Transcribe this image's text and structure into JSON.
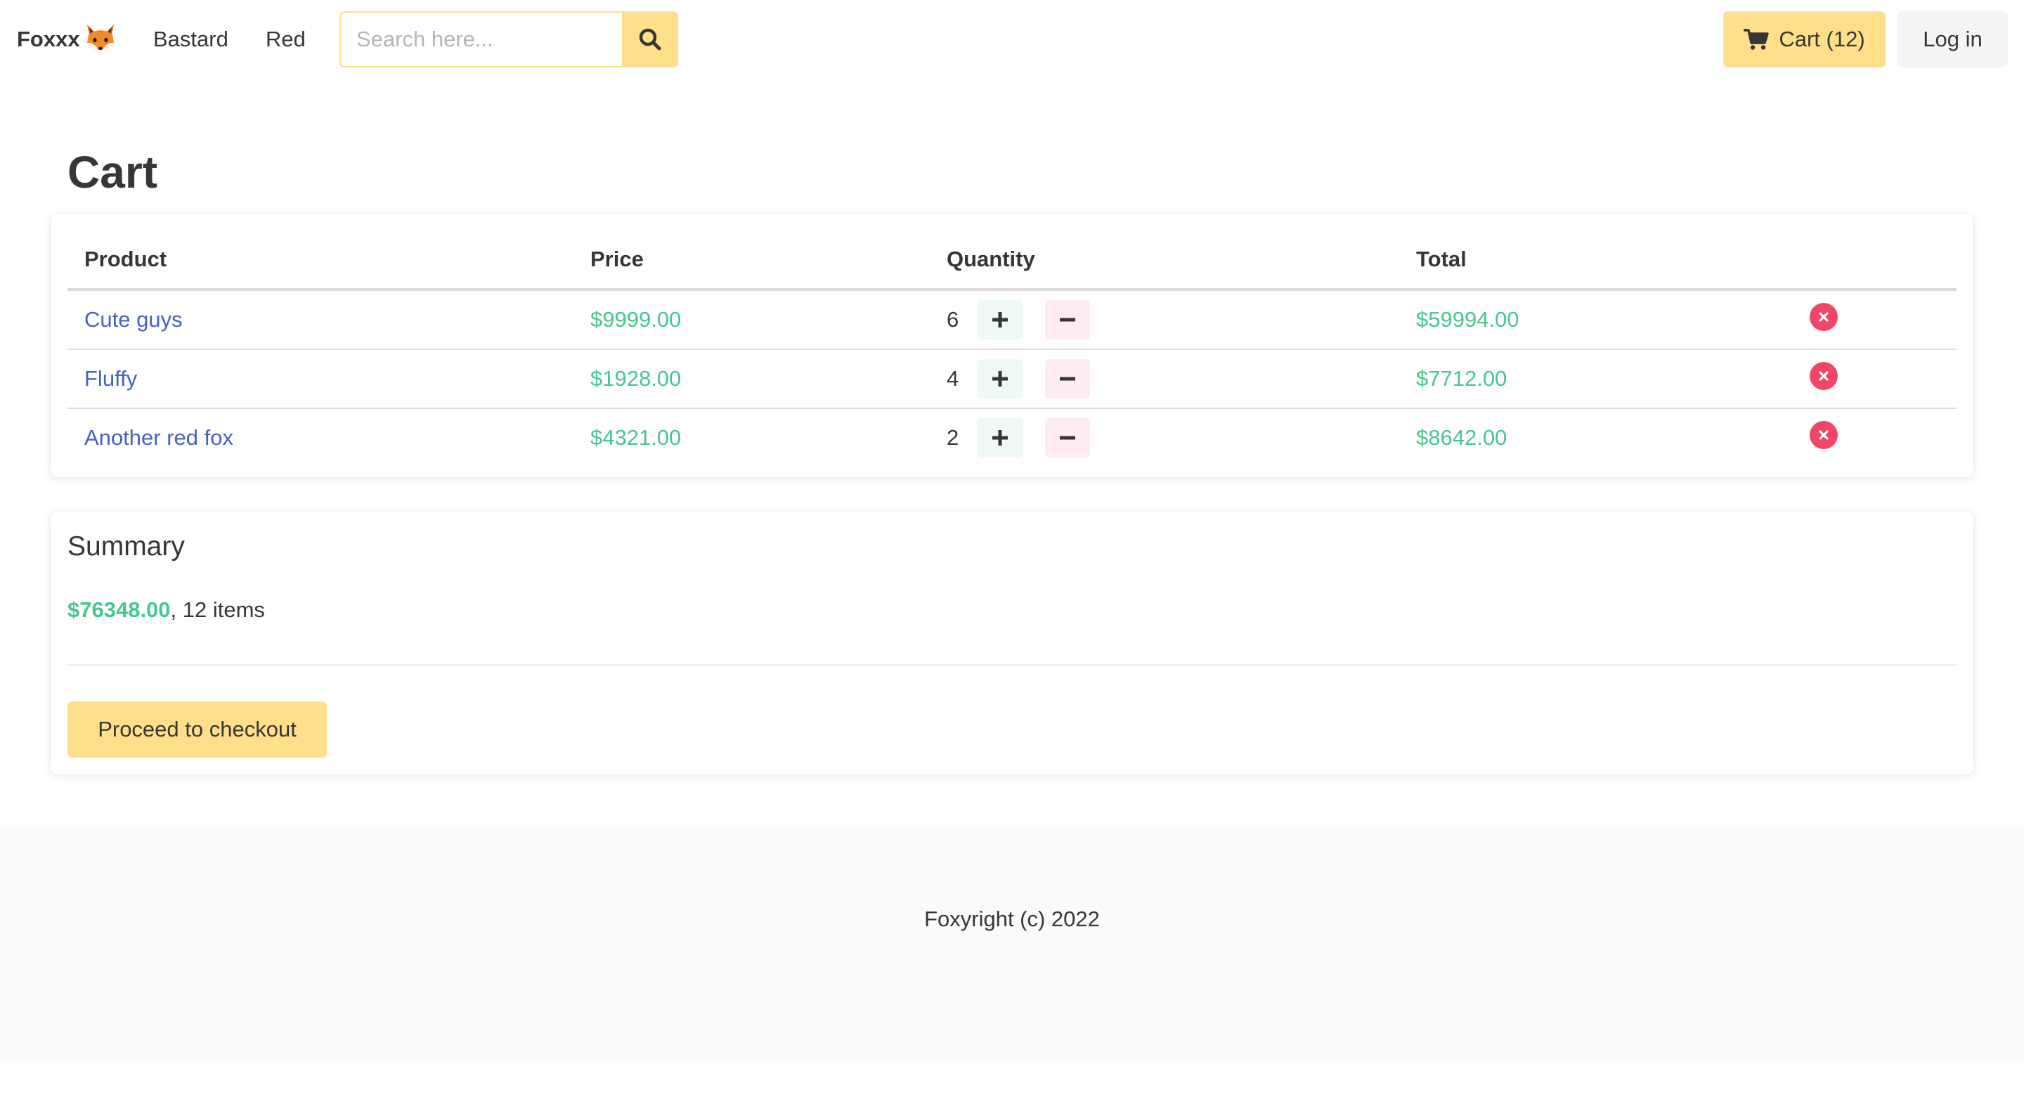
{
  "colors": {
    "accent_yellow": "#ffe08a",
    "link_blue": "#485fc7",
    "money_green": "#48c78e",
    "danger_red": "#f14668",
    "plus_bg": "#effaf5",
    "minus_bg": "#feecf0",
    "footer_bg": "#fafafa"
  },
  "navbar": {
    "brand": "Foxxx",
    "brand_icon": "fox-emoji-icon",
    "links": [
      "Bastard",
      "Red"
    ],
    "search": {
      "placeholder": "Search here...",
      "value": "",
      "icon": "search-icon"
    },
    "cart_label": "Cart (12)",
    "cart_icon": "shopping-cart-icon",
    "login_label": "Log in"
  },
  "page": {
    "title": "Cart"
  },
  "cart_table": {
    "headers": [
      "Product",
      "Price",
      "Quantity",
      "Total"
    ],
    "rows": [
      {
        "product": "Cute guys",
        "price": "$9999.00",
        "quantity": "6",
        "total": "$59994.00"
      },
      {
        "product": "Fluffy",
        "price": "$1928.00",
        "quantity": "4",
        "total": "$7712.00"
      },
      {
        "product": "Another red fox",
        "price": "$4321.00",
        "quantity": "2",
        "total": "$8642.00"
      }
    ],
    "plus_icon": "plus-icon",
    "minus_icon": "minus-icon",
    "remove_icon": "close-circle-icon"
  },
  "summary": {
    "title": "Summary",
    "amount": "$76348.00",
    "items_text": ", 12 items",
    "checkout_label": "Proceed to checkout"
  },
  "footer": {
    "text": "Foxyright (c) 2022"
  }
}
